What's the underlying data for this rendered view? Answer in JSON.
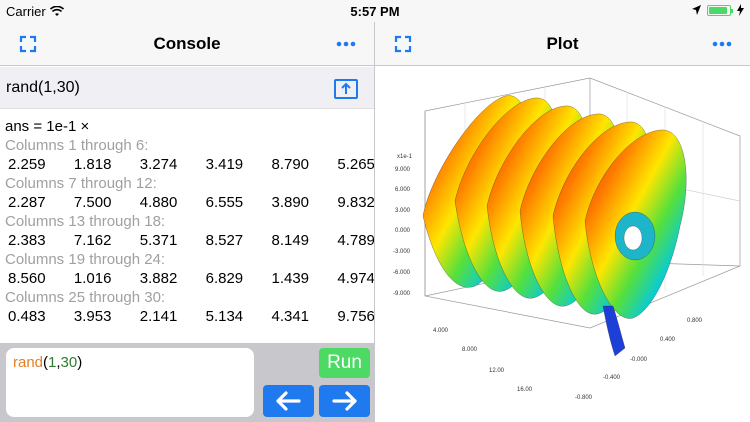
{
  "status": {
    "carrier": "Carrier",
    "time": "5:57 PM",
    "battery_level": 0.9
  },
  "console": {
    "title": "Console",
    "expand_icon": "expand-icon",
    "more_icon": "more-icon",
    "command": "rand(1,30)",
    "share_icon": "share-icon",
    "output": {
      "ans": "ans = 1e-1 ×",
      "groups": [
        {
          "label": "Columns 1 through 6:",
          "values": "2.259  1.818  3.274  3.419  8.790  5.265"
        },
        {
          "label": "Columns 7 through 12:",
          "values": "2.287  7.500  4.880  6.555  3.890  9.832"
        },
        {
          "label": "Columns 13 through 18:",
          "values": "2.383  7.162  5.371  8.527  8.149  4.789"
        },
        {
          "label": "Columns 19 through 24:",
          "values": "8.560  1.016  3.882  6.829  1.439  4.974"
        },
        {
          "label": "Columns 25 through 30:",
          "values": "0.483  3.953  2.141  5.134  4.341  9.756"
        }
      ]
    },
    "input": {
      "fn": "rand",
      "open": "(",
      "arg1": "1",
      "comma": ",",
      "arg2": "30",
      "close": ")"
    },
    "run_label": "Run",
    "run_color": "#4cd964",
    "arrow_color": "#1f7af0"
  },
  "plot": {
    "title": "Plot",
    "scale_label": "x1e-1",
    "z_ticks": [
      "9.000",
      "6.000",
      "3.000",
      "0.000",
      "-3.000",
      "-6.000",
      "-9.000"
    ],
    "x_ticks": [
      "4.000",
      "8.000",
      "12.00",
      "16.00"
    ],
    "y_ticks": [
      "0.800",
      "0.400",
      "-0.000",
      "-0.400",
      "-0.800"
    ]
  }
}
